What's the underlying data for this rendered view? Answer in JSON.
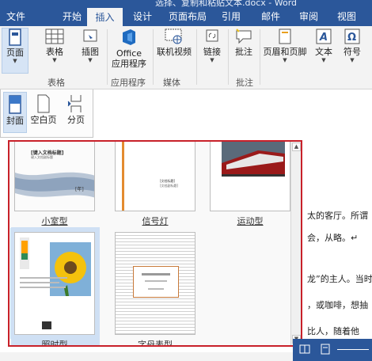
{
  "window": {
    "title": "选择、复制和粘贴文本.docx - Word"
  },
  "tabs": [
    "文件",
    "开始",
    "插入",
    "设计",
    "页面布局",
    "引用",
    "邮件",
    "审阅",
    "视图"
  ],
  "ribbon": {
    "pages": "页面",
    "table": "表格",
    "pictures": "插图",
    "office_apps_line1": "Office",
    "office_apps_line2": "应用程序",
    "online_video": "联机视频",
    "link": "链接",
    "comment": "批注",
    "header_footer": "页眉和页脚",
    "text": "文本",
    "symbols": "符号",
    "groups": {
      "table": "表格",
      "apps": "应用程序",
      "media": "媒体",
      "comments": "批注"
    }
  },
  "pages_menu": {
    "cover": "封面",
    "blank": "空白页",
    "break": "分页"
  },
  "gallery": {
    "items": [
      {
        "label": "小室型"
      },
      {
        "label": "信号灯"
      },
      {
        "label": "运动型"
      },
      {
        "label": "照时型"
      },
      {
        "label": "字母表型"
      }
    ],
    "thumb_text": {
      "austin_title": "[键入文档标题]",
      "austin_subtitle": "键入文档副标题",
      "austin_year": "[年]",
      "signal_title": "[文档标题]",
      "signal_sub": "[文档副标题]"
    }
  },
  "document": {
    "lines": [
      "太的客厅。所谓",
      "会，从略。↵",
      "龙”的主人。当时",
      "，或咖啡，想抽",
      "比人，随着他"
    ]
  },
  "colors": {
    "brand": "#2b579a",
    "highlight": "#c8212a",
    "ribbon_bg": "#f3f3f3"
  }
}
